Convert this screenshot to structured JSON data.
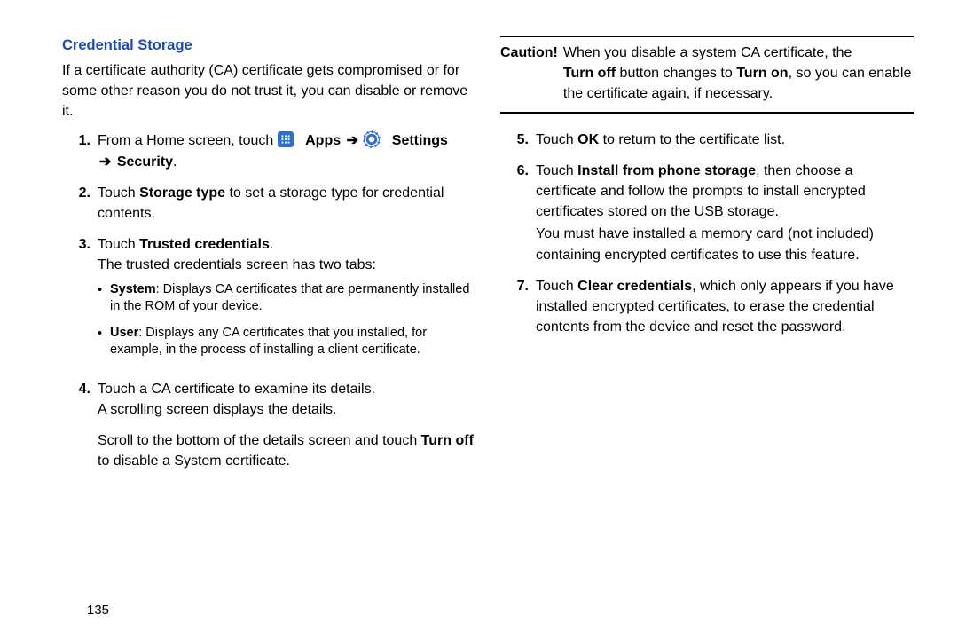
{
  "page_number": "135",
  "left": {
    "heading": "Credential Storage",
    "intro": "If a certificate authority (CA) certificate gets compromised or for some other reason you do not trust it, you can disable or remove it.",
    "steps": {
      "s1_num": "1.",
      "s1_a": "From a Home screen, touch ",
      "s1_apps": "Apps",
      "s1_settings": "Settings",
      "s1_security": "Security",
      "s1_arrow": "➔",
      "s1_period": ".",
      "s2_num": "2.",
      "s2_a": "Touch ",
      "s2_b": "Storage type",
      "s2_c": " to set a storage type for credential contents.",
      "s3_num": "3.",
      "s3_a": "Touch ",
      "s3_b": "Trusted credentials",
      "s3_c": ".",
      "s3_d": "The trusted credentials screen has two tabs:",
      "s3_sub": {
        "i1_b": "System",
        "i1_t": ": Displays CA certificates that are permanently installed in the ROM of your device.",
        "i2_b": "User",
        "i2_t": ": Displays any CA certificates that you installed, for example, in the process of installing a client certificate."
      },
      "s4_num": "4.",
      "s4_a": "Touch a CA certificate to examine its details.",
      "s4_b": "A scrolling screen displays the details.",
      "s4_c1": "Scroll to the bottom of the details screen and touch ",
      "s4_c2": "Turn off",
      "s4_c3": " to disable a System certificate."
    }
  },
  "right": {
    "caution": {
      "label": "Caution!",
      "l1_a": "When you disable a system CA certificate, the ",
      "l2_a": "Turn off",
      "l2_b": " button changes to ",
      "l2_c": "Turn on",
      "l2_d": ", so you can enable the certificate again, if necessary."
    },
    "steps": {
      "s5_num": "5.",
      "s5_a": "Touch ",
      "s5_b": "OK",
      "s5_c": " to return to the certificate list.",
      "s6_num": "6.",
      "s6_a": "Touch ",
      "s6_b": "Install from phone storage",
      "s6_c": ", then choose a certificate and follow the prompts to install encrypted certificates stored on the USB storage.",
      "s6_d": "You must have installed a memory card (not included) containing encrypted certificates to use this feature.",
      "s7_num": "7.",
      "s7_a": "Touch ",
      "s7_b": "Clear credentials",
      "s7_c": ", which only appears if you have installed encrypted certificates, to erase the credential contents from the device and reset the password."
    }
  }
}
